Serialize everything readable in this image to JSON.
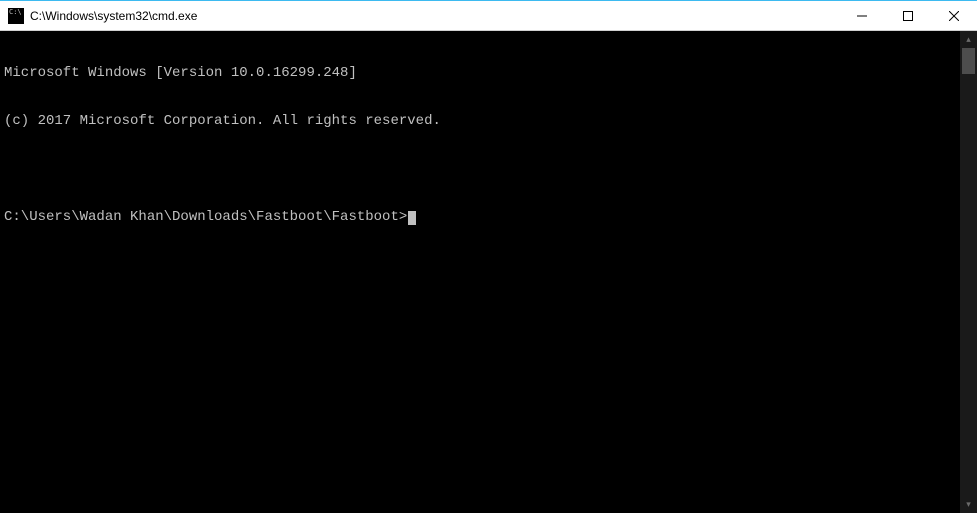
{
  "window": {
    "title": "C:\\Windows\\system32\\cmd.exe"
  },
  "terminal": {
    "line1": "Microsoft Windows [Version 10.0.16299.248]",
    "line2": "(c) 2017 Microsoft Corporation. All rights reserved.",
    "blank": "",
    "prompt": "C:\\Users\\Wadan Khan\\Downloads\\Fastboot\\Fastboot>"
  }
}
